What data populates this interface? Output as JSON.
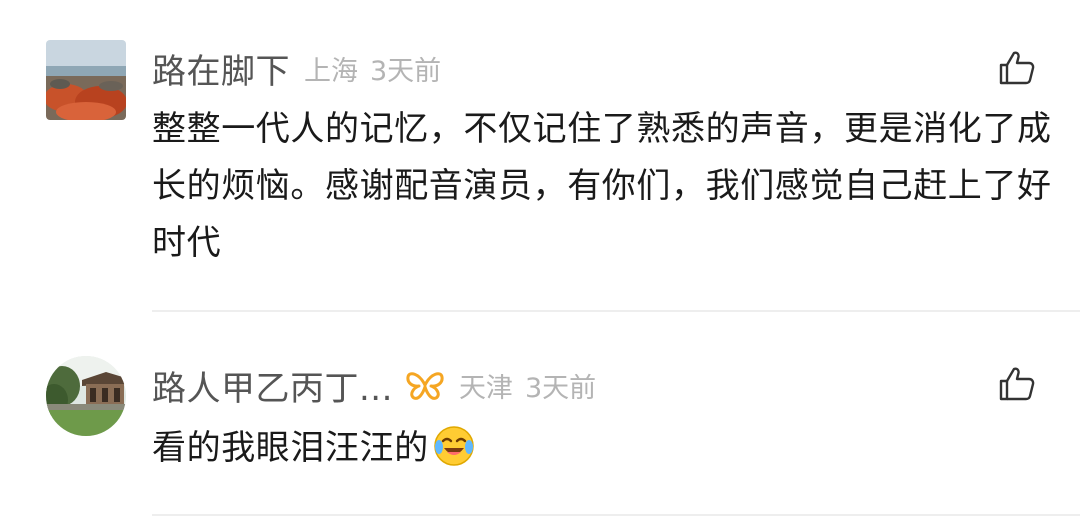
{
  "comments": [
    {
      "username": "路在脚下",
      "location": "上海",
      "time": "3天前",
      "text": "整整一代人的记忆，不仅记住了熟悉的声音，更是消化了成长的烦恼。感谢配音演员，有你们，我们感觉自己赶上了好时代",
      "avatar": "landscape-photo-avatar",
      "like_icon": "thumbs-up-icon"
    },
    {
      "username": "路人甲乙丙丁...",
      "location": "天津",
      "time": "3天前",
      "text": "看的我眼泪汪汪的",
      "avatar": "pavilion-photo-avatar",
      "badge_icon": "vip-butterfly-icon",
      "emoji": "crying-laughing-emoji",
      "like_icon": "thumbs-up-icon"
    }
  ],
  "colors": {
    "username": "#555555",
    "meta": "#b4b4b4",
    "text": "#1a1a1a",
    "badge": "#f5a623",
    "divider": "#eeeeee"
  }
}
